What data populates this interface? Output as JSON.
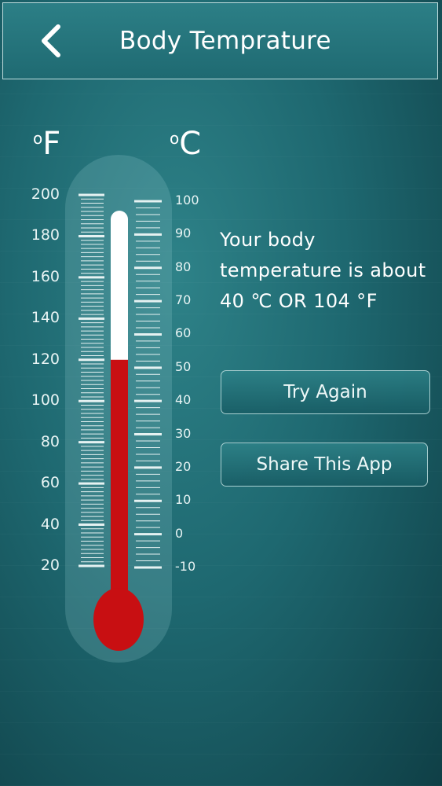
{
  "header": {
    "title": "Body Temprature",
    "back_icon": "chevron-left-icon"
  },
  "thermometer": {
    "fahrenheit_unit": "F",
    "celsius_unit": "C",
    "unit_degree_symbol": "o",
    "fahrenheit_ticks": [
      "200",
      "180",
      "160",
      "140",
      "120",
      "100",
      "80",
      "60",
      "40",
      "20"
    ],
    "celsius_ticks": [
      "100",
      "90",
      "80",
      "70",
      "60",
      "50",
      "40",
      "30",
      "20",
      "10",
      "0",
      "-10"
    ],
    "mercury_level_fahrenheit": 120,
    "mercury_color": "#c80f12",
    "tube_color": "#ffffff"
  },
  "result": {
    "message": "Your body temperature is about 40 ℃ OR 104 °F"
  },
  "buttons": {
    "try_again": "Try Again",
    "share": "Share This App"
  }
}
